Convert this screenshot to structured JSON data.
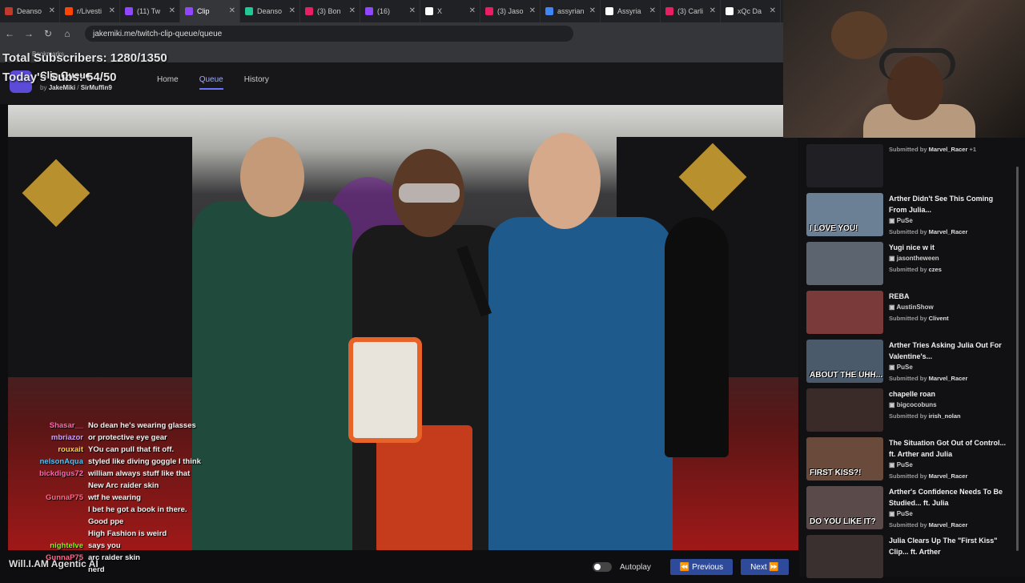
{
  "browser": {
    "tabs": [
      {
        "label": "Deanso",
        "color": "#c0392b"
      },
      {
        "label": "r/Livesti",
        "color": "#ff4500"
      },
      {
        "label": "(11) Tw",
        "color": "#9146ff"
      },
      {
        "label": "Clip",
        "color": "#9146ff"
      },
      {
        "label": "Deanso",
        "color": "#20c997"
      },
      {
        "label": "(3) Bon",
        "color": "#e91e63"
      },
      {
        "label": "(16)",
        "color": "#9146ff"
      },
      {
        "label": "X",
        "color": "#ffffff"
      },
      {
        "label": "(3) Jaso",
        "color": "#e91e63"
      },
      {
        "label": "assyrian",
        "color": "#4285f4"
      },
      {
        "label": "Assyria",
        "color": "#ffffff"
      },
      {
        "label": "(3) Carli",
        "color": "#e91e63"
      },
      {
        "label": "xQc Da",
        "color": "#ffffff"
      }
    ],
    "url": "jakemiki.me/twitch-clip-queue/queue",
    "bookmarks_label": "Bookmarks"
  },
  "overlay": {
    "total_subs": "Total Subscribers: 1280/1350",
    "today_subs": "Today's Subs: 54/50",
    "caption": "Will.I.AM Agentic AI"
  },
  "app": {
    "title": "Clip Queue",
    "by": "by",
    "author1": "JakeMiki",
    "author2": "SirMuffin9",
    "nav": [
      "Home",
      "Queue",
      "History"
    ]
  },
  "chat": [
    {
      "user": "Shasar__",
      "color": "#ff69b4",
      "text": "No dean he's wearing glasses"
    },
    {
      "user": "mbriazor",
      "color": "#d0a0ff",
      "text": "or protective eye gear"
    },
    {
      "user": "rouxait",
      "color": "#ffd23f",
      "text": "YOu can pull that fit off."
    },
    {
      "user": "nelsonAqua",
      "color": "#4fc3f7",
      "text": "styled like diving goggle I think"
    },
    {
      "user": "bickdigus72",
      "color": "#ff69b4",
      "text": "william always stuff like that"
    },
    {
      "user": "",
      "color": "#3b5bdb",
      "text": "New Arc raider skin"
    },
    {
      "user": "GunnaP75",
      "color": "#ff6b8b",
      "text": "wtf he wearing"
    },
    {
      "user": "",
      "color": "#c2185b",
      "text": "I bet he got a book in there."
    },
    {
      "user": "",
      "color": "#e53935",
      "text": "Good ppe"
    },
    {
      "user": "",
      "color": "#3b5bdb",
      "text": "High Fashion is weird"
    },
    {
      "user": "nighteIve",
      "color": "#7cfc00",
      "text": "says you"
    },
    {
      "user": "GunnaP75",
      "color": "#ff6b8b",
      "text": "arc raider skin"
    },
    {
      "user": "",
      "color": "#3b5bdb",
      "text": "nerd"
    }
  ],
  "controls": {
    "autoplay": "Autoplay",
    "previous": "Previous",
    "next": "Next"
  },
  "queue": [
    {
      "title": "",
      "channel": "",
      "submitted": "Submitted by",
      "submitter": "Marvel_Racer",
      "extra": "+1",
      "thumb_text": "",
      "thumb_bg": "#202024"
    },
    {
      "title": "Arther Didn't See This Coming From Julia...",
      "channel": "PuSe",
      "submitted": "Submitted by",
      "submitter": "Marvel_Racer",
      "extra": "",
      "thumb_text": "I LOVE YOU!",
      "thumb_bg": "#6b7f95"
    },
    {
      "title": "Yugi nice w it",
      "channel": "jasontheween",
      "submitted": "Submitted by",
      "submitter": "czes",
      "extra": "",
      "thumb_text": "",
      "thumb_bg": "#5c6470"
    },
    {
      "title": "REBA",
      "channel": "AustinShow",
      "submitted": "Submitted by",
      "submitter": "Clivent",
      "extra": "",
      "thumb_text": "",
      "thumb_bg": "#7a3a3a"
    },
    {
      "title": "Arther Tries Asking Julia Out For Valentine's...",
      "channel": "PuSe",
      "submitted": "Submitted by",
      "submitter": "Marvel_Racer",
      "extra": "",
      "thumb_text": "ABOUT THE UHH...",
      "thumb_bg": "#4a5a6a"
    },
    {
      "title": "chapelle roan",
      "channel": "bigcocobuns",
      "submitted": "Submitted by",
      "submitter": "irish_nolan",
      "extra": "",
      "thumb_text": "",
      "thumb_bg": "#3a2a28"
    },
    {
      "title": "The Situation Got Out of Control... ft. Arther and Julia",
      "channel": "PuSe",
      "submitted": "Submitted by",
      "submitter": "Marvel_Racer",
      "extra": "",
      "thumb_text": "FIRST KISS?!",
      "thumb_bg": "#6a4a3a"
    },
    {
      "title": "Arther's Confidence Needs To Be Studied... ft. Julia",
      "channel": "PuSe",
      "submitted": "Submitted by",
      "submitter": "Marvel_Racer",
      "extra": "",
      "thumb_text": "DO YOU LIKE IT?",
      "thumb_bg": "#5a4a4a"
    },
    {
      "title": "Julia Clears Up The \"First Kiss\" Clip... ft. Arther",
      "channel": "",
      "submitted": "",
      "submitter": "",
      "extra": "",
      "thumb_text": "",
      "thumb_bg": "#3a3030"
    }
  ]
}
